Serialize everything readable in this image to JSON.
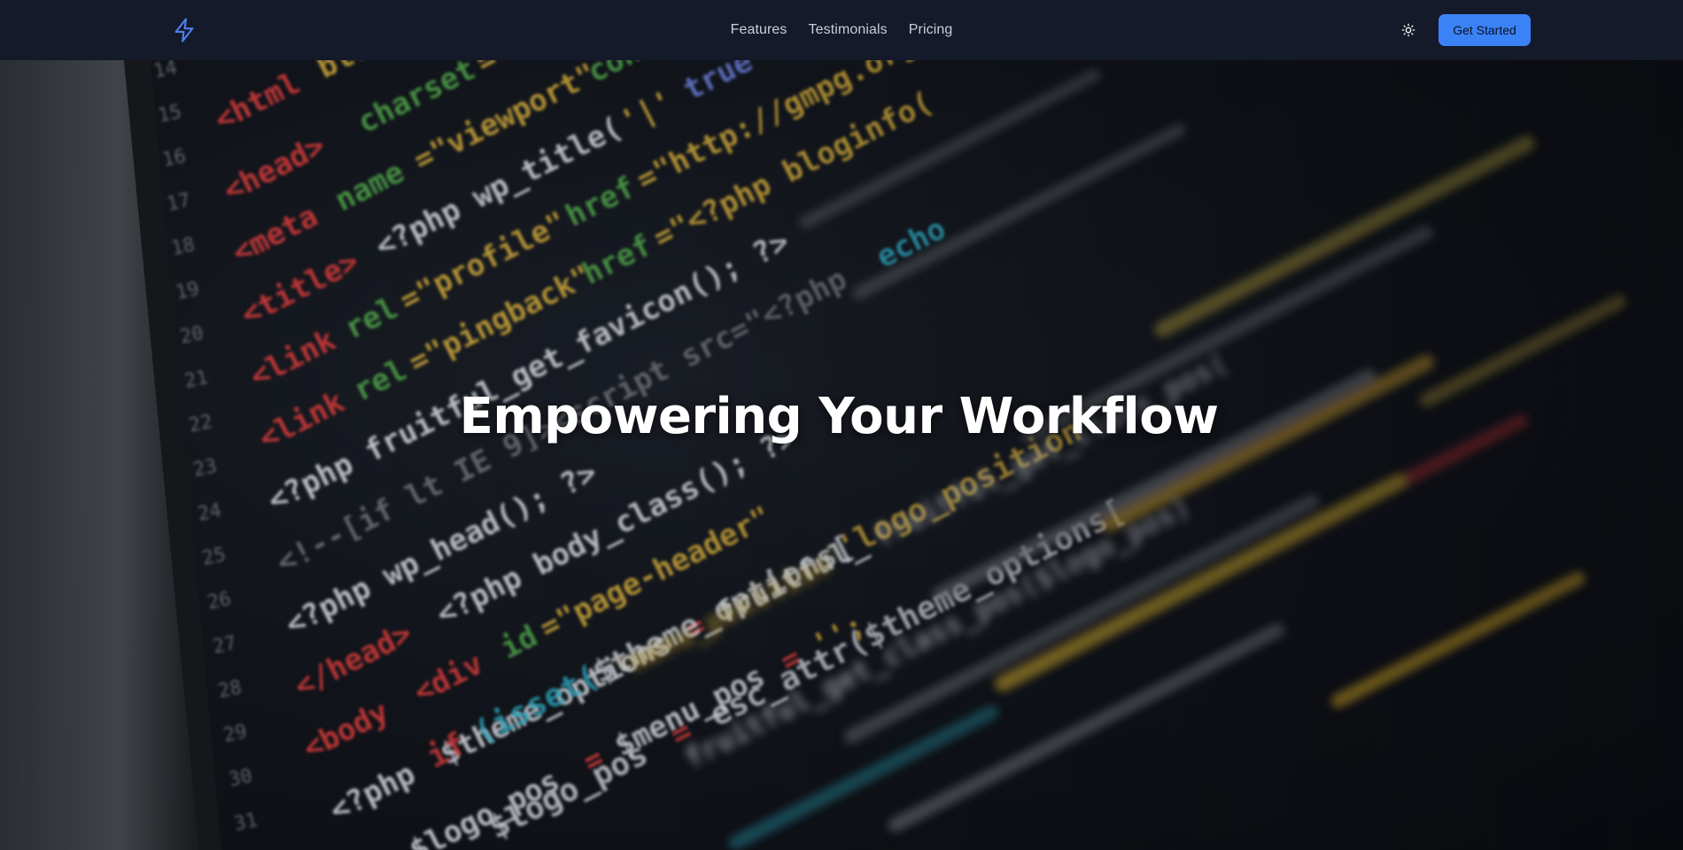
{
  "header": {
    "logo_icon": "lightning-bolt-icon",
    "nav": [
      {
        "label": "Features"
      },
      {
        "label": "Testimonials"
      },
      {
        "label": "Pricing"
      }
    ],
    "theme_toggle_icon": "sun-icon",
    "cta_label": "Get Started"
  },
  "hero": {
    "title": "Empowering Your Workflow",
    "background_description_icon": "code-editor-background-image"
  },
  "colors": {
    "header_bg": "#141a29",
    "accent": "#3b82f6",
    "nav_text": "#c9ced8",
    "hero_title": "#ffffff"
  }
}
